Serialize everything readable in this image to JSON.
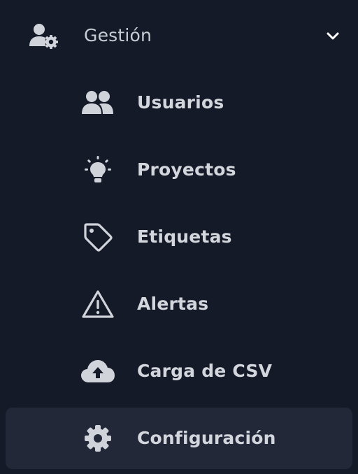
{
  "group": {
    "label": "Gestión",
    "icon": "user-gear-icon",
    "expanded": true,
    "chevron_icon": "chevron-down-icon"
  },
  "items": [
    {
      "label": "Usuarios",
      "icon": "users-icon",
      "active": false
    },
    {
      "label": "Proyectos",
      "icon": "lightbulb-icon",
      "active": false
    },
    {
      "label": "Etiquetas",
      "icon": "tag-icon",
      "active": false
    },
    {
      "label": "Alertas",
      "icon": "warning-icon",
      "active": false
    },
    {
      "label": "Carga de CSV",
      "icon": "cloud-upload-icon",
      "active": false
    },
    {
      "label": "Configuración",
      "icon": "gear-icon",
      "active": true
    }
  ],
  "colors": {
    "background": "#151a28",
    "active_background": "#222838",
    "text": "#d3d6dd",
    "icon": "#d0d3da"
  }
}
